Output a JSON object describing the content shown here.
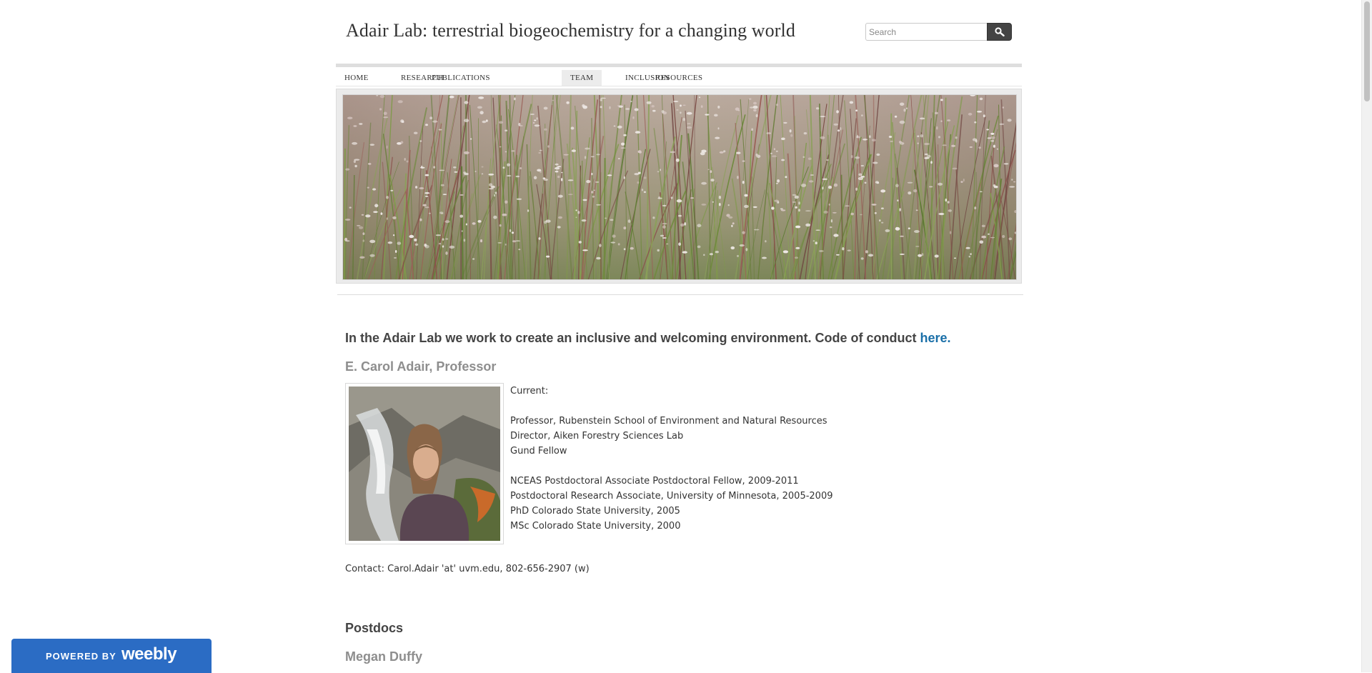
{
  "header": {
    "site_title": "Adair Lab: terrestrial biogeochemistry for a changing world",
    "search_placeholder": "Search"
  },
  "nav": {
    "items": [
      {
        "label": "HOME"
      },
      {
        "label": "RESEARCH"
      },
      {
        "label": "PUBLICATIONS"
      },
      {
        "label": "TEAM",
        "active": true
      },
      {
        "label": "INCLUSION"
      },
      {
        "label": "RESOURCES"
      }
    ]
  },
  "main": {
    "intro_text": "In the Adair Lab we work to create an inclusive and welcoming environment. Code of conduct ",
    "intro_link": "here",
    "intro_end": ".",
    "pi": {
      "name": "E. Carol Adair, Professor",
      "bio": [
        "Current:",
        "",
        "Professor, Rubenstein School of Environment and Natural Resources",
        "Director, Aiken Forestry Sciences Lab",
        "Gund Fellow",
        "",
        "NCEAS Postdoctoral Associate Postdoctoral Fellow, 2009-2011",
        "Postdoctoral Research Associate, University of Minnesota, 2005-2009",
        "PhD Colorado State University, 2005",
        "MSc Colorado State University, 2000"
      ],
      "contact": "Contact: Carol.Adair 'at' uvm.edu, 802-656-2907 (w)"
    },
    "postdocs_heading": "Postdocs",
    "postdoc_name": "Megan Duffy"
  },
  "badge": {
    "powered_by": "POWERED BY",
    "brand": "weebly"
  },
  "colors": {
    "link": "#1a6fa8",
    "badge_bg": "#2b6cc4",
    "name_gray": "#8e8e8e"
  }
}
